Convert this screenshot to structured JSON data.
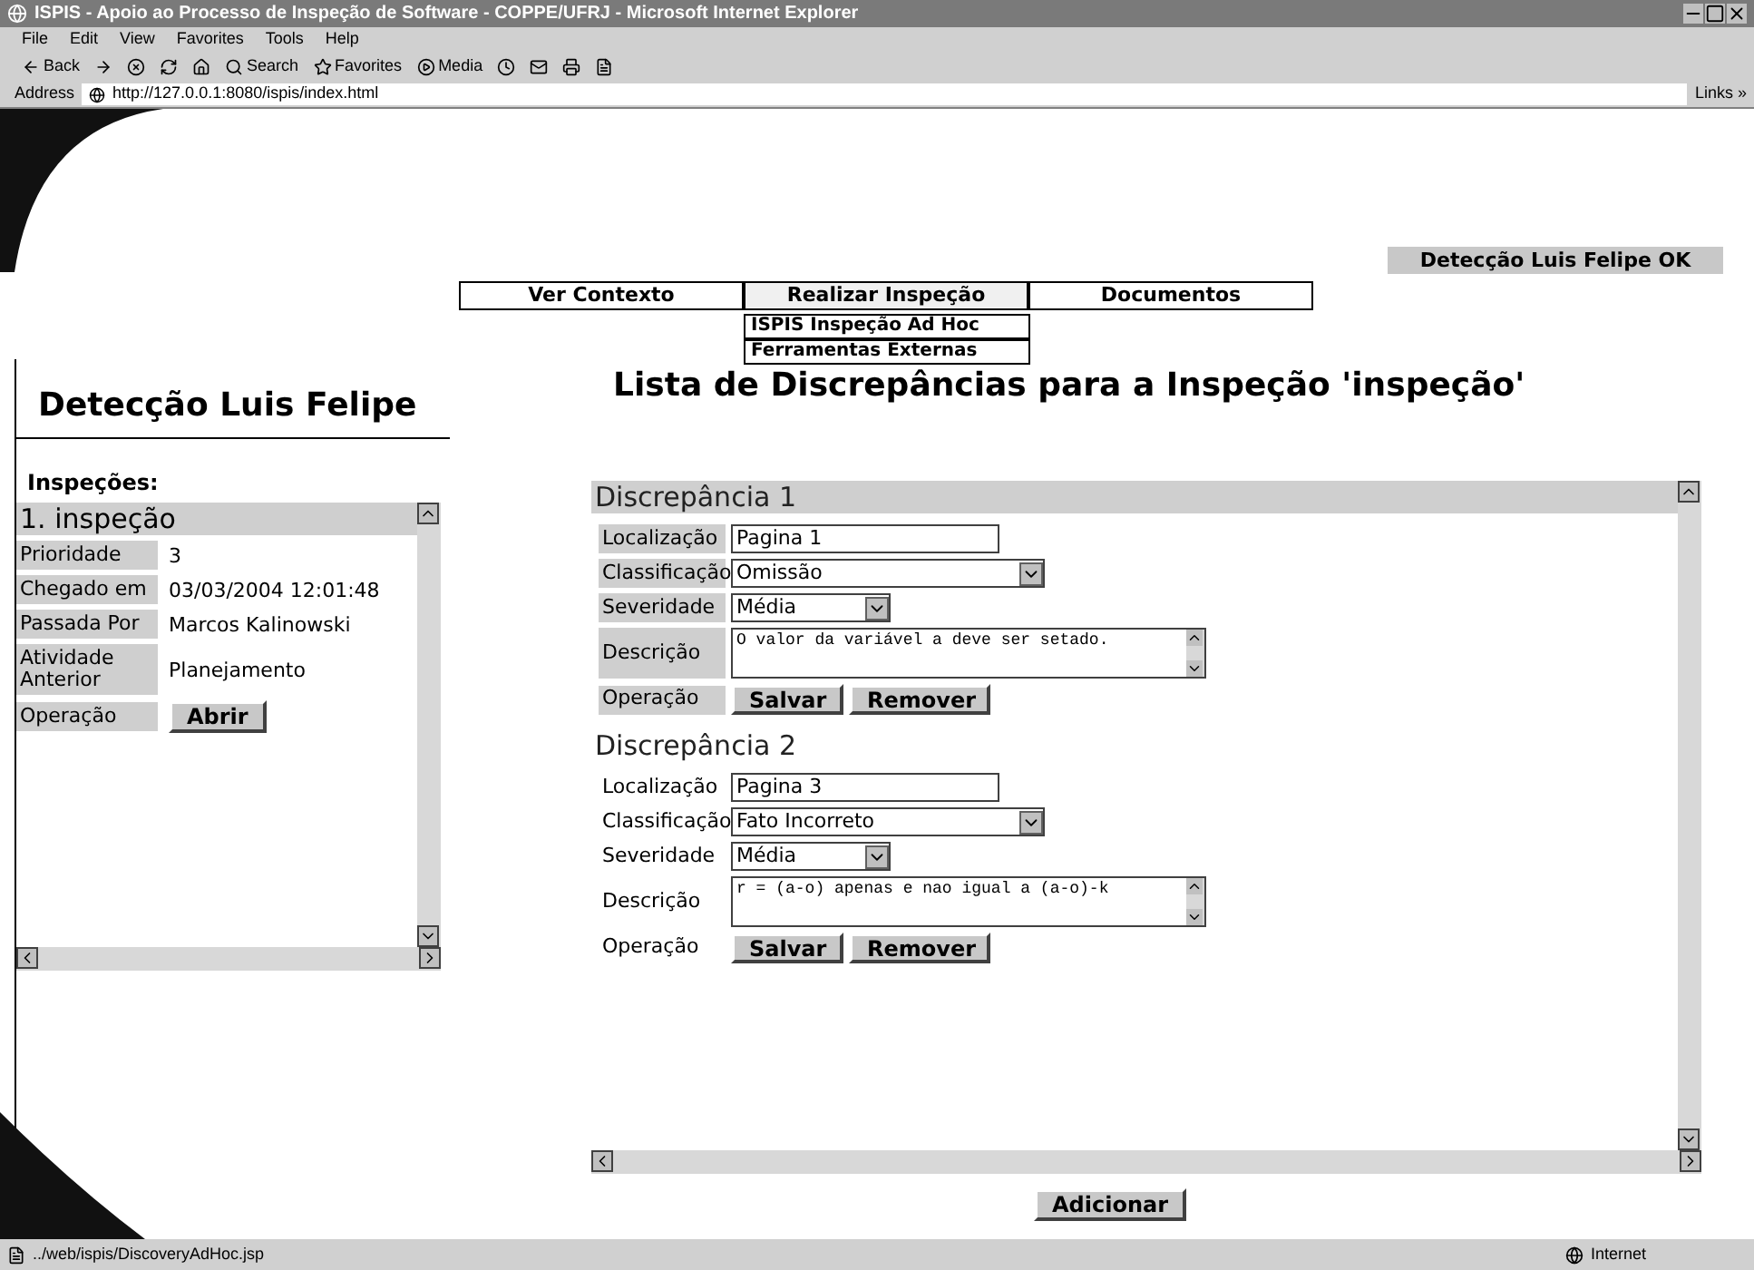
{
  "window": {
    "title": "ISPIS - Apoio ao Processo de Inspeção de Software - COPPE/UFRJ - Microsoft Internet Explorer"
  },
  "menu_bar": [
    "File",
    "Edit",
    "View",
    "Favorites",
    "Tools",
    "Help"
  ],
  "toolbar": {
    "back": "Back",
    "search": "Search",
    "favorites": "Favorites",
    "media": "Media"
  },
  "address_bar": {
    "label": "Address",
    "url": "http://127.0.0.1:8080/ispis/index.html",
    "links": "Links »"
  },
  "user_badge": "Detecção Luis Felipe OK",
  "nav": [
    {
      "label": "Ver Contexto",
      "expanded": false
    },
    {
      "label": "Realizar Inspeção",
      "expanded": true,
      "children": [
        "ISPIS Inspeção Ad Hoc",
        "Ferramentas Externas"
      ]
    },
    {
      "label": "Documentos",
      "expanded": false
    }
  ],
  "left": {
    "title": "Detecção Luis Felipe",
    "section": "Inspeções:",
    "inspection": {
      "name": "1. inspeção",
      "fields": [
        {
          "label": "Prioridade",
          "value": "3"
        },
        {
          "label": "Chegado em",
          "value": "03/03/2004 12:01:48"
        },
        {
          "label": "Passada Por",
          "value": "Marcos Kalinowski"
        },
        {
          "label": "Atividade Anterior",
          "value": "Planejamento"
        }
      ],
      "operation": {
        "label": "Operação",
        "button": "Abrir"
      }
    }
  },
  "right": {
    "title": "Lista de Discrepâncias para a Inspeção 'inspeção'",
    "discrepancies": [
      {
        "title": "Discrepância 1",
        "selected": true,
        "labels": [
          "Localização",
          "Classificação",
          "Severidade",
          "Descrição",
          "Operação"
        ],
        "location": "Pagina 1",
        "classification": "Omissão",
        "severity": "Média",
        "description": "O valor da variável a deve ser setado.",
        "buttons": [
          "Salvar",
          "Remover"
        ]
      },
      {
        "title": "Discrepância 2",
        "selected": false,
        "labels": [
          "Localização",
          "Classificação",
          "Severidade",
          "Descrição",
          "Operação"
        ],
        "location": "Pagina 3",
        "classification": "Fato Incorreto",
        "severity": "Média",
        "description": "r = (a-o) apenas e nao igual a (a-o)-k",
        "buttons": [
          "Salvar",
          "Remover"
        ]
      }
    ],
    "add_button": "Adicionar"
  },
  "status_bar": {
    "url": "../web/ispis/DiscoveryAdHoc.jsp",
    "zone": "Internet"
  }
}
